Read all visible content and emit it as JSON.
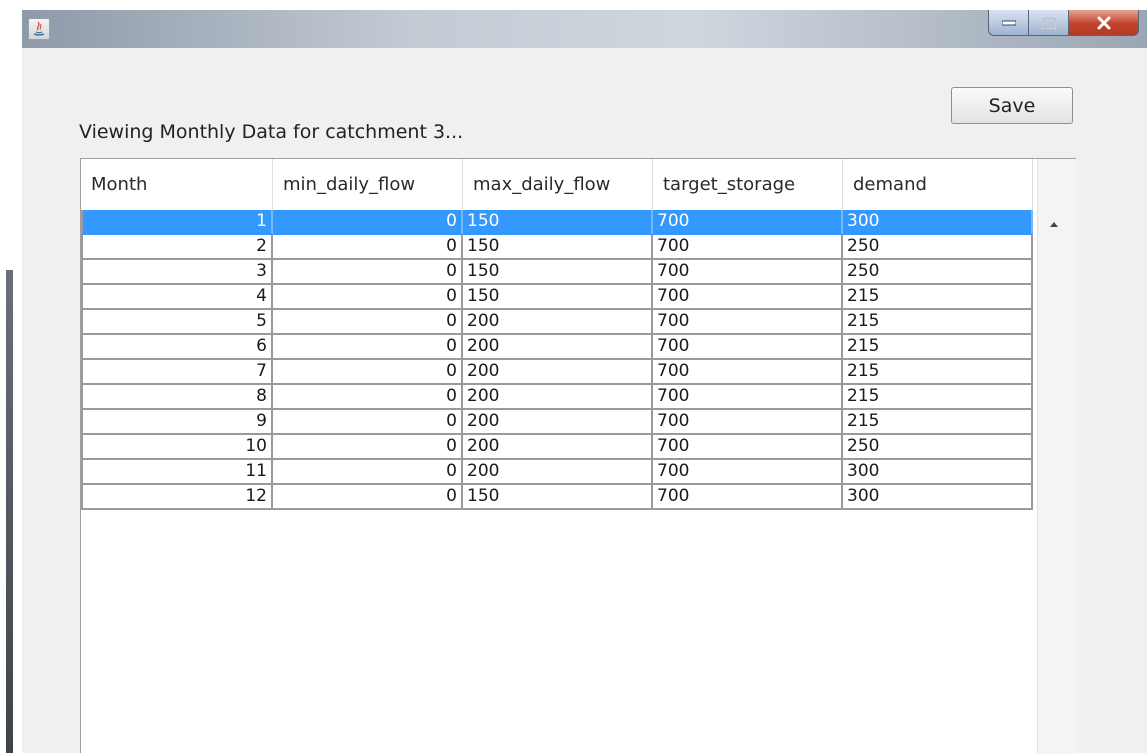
{
  "window": {
    "controls": {
      "minimize": "minimize-icon",
      "maximize": "maximize-icon",
      "close": "close-icon"
    }
  },
  "heading": "Viewing Monthly Data for catchment 3...",
  "toolbar": {
    "save_label": "Save"
  },
  "table": {
    "columns": [
      "Month",
      "min_daily_flow",
      "max_daily_flow",
      "target_storage",
      "demand"
    ],
    "selected_row": 0,
    "selection_color": "#3399ff",
    "rows": [
      [
        "1",
        "0",
        "150",
        "700",
        "300"
      ],
      [
        "2",
        "0",
        "150",
        "700",
        "250"
      ],
      [
        "3",
        "0",
        "150",
        "700",
        "250"
      ],
      [
        "4",
        "0",
        "150",
        "700",
        "215"
      ],
      [
        "5",
        "0",
        "200",
        "700",
        "215"
      ],
      [
        "6",
        "0",
        "200",
        "700",
        "215"
      ],
      [
        "7",
        "0",
        "200",
        "700",
        "215"
      ],
      [
        "8",
        "0",
        "200",
        "700",
        "215"
      ],
      [
        "9",
        "0",
        "200",
        "700",
        "215"
      ],
      [
        "10",
        "0",
        "200",
        "700",
        "250"
      ],
      [
        "11",
        "0",
        "200",
        "700",
        "300"
      ],
      [
        "12",
        "0",
        "150",
        "700",
        "300"
      ]
    ]
  }
}
